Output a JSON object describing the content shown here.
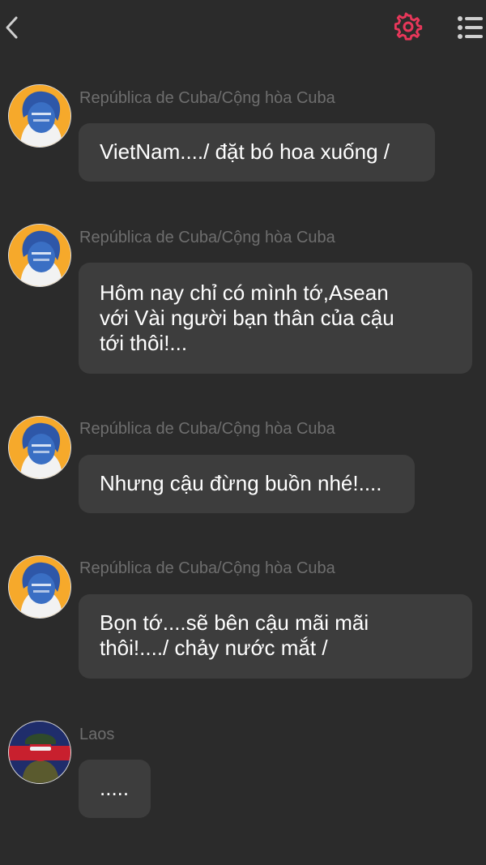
{
  "header": {
    "back_icon": "chevron-left-icon",
    "settings_icon": "gear-icon",
    "menu_icon": "list-menu-icon",
    "accent_color": "#e8375a"
  },
  "messages": [
    {
      "sender": "República de Cuba/Cộng hòa Cuba",
      "text": "VietNam..../ đặt bó hoa xuống /"
    },
    {
      "sender": "República de Cuba/Cộng hòa Cuba",
      "text": "Hôm nay chỉ có mình tớ,Asean\nvới Vài người bạn thân của cậu\ntới thôi!..."
    },
    {
      "sender": "República de Cuba/Cộng hòa Cuba",
      "text": "Nhưng cậu đừng buồn nhé!...."
    },
    {
      "sender": "República de Cuba/Cộng hòa Cuba",
      "text": "Bọn tớ....sẽ bên cậu mãi mãi\nthôi!..../ chảy nước mắt /"
    },
    {
      "sender": "Laos",
      "text": "....."
    }
  ]
}
